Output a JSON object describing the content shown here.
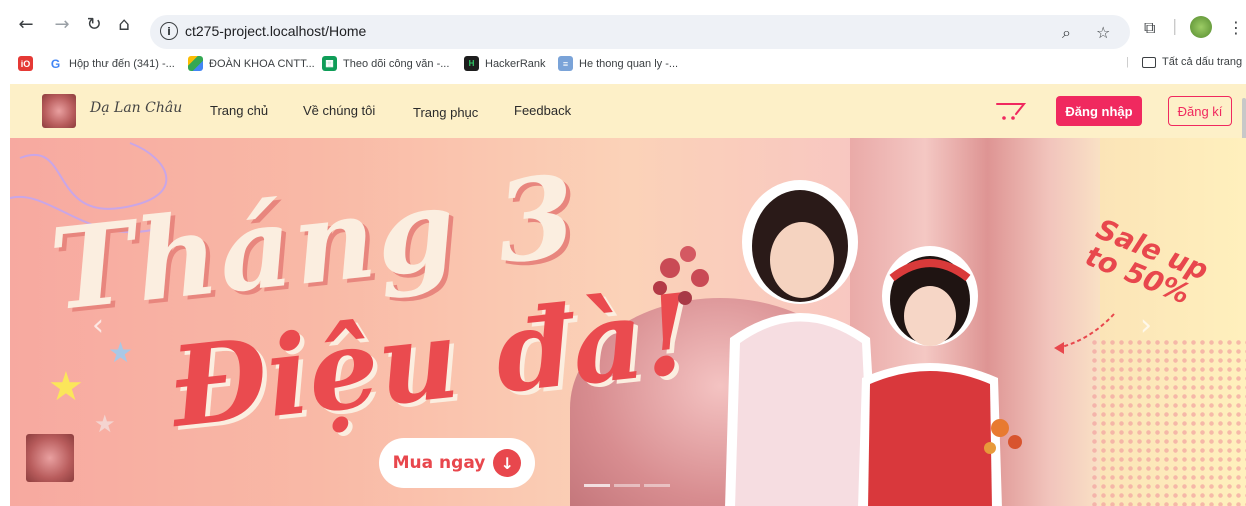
{
  "browser": {
    "url": "ct275-project.localhost/Home",
    "bookmarks": [
      {
        "label": "Hộp thư đến (341) -...",
        "icon": "gmail-icon"
      },
      {
        "label": "ĐOÀN KHOA CNTT...",
        "icon": "drive-icon"
      },
      {
        "label": "Theo dõi công văn -...",
        "icon": "sheets-icon"
      },
      {
        "label": "HackerRank",
        "icon": "hackerrank-icon"
      },
      {
        "label": "He thong quan ly -...",
        "icon": "table-icon"
      }
    ],
    "all_bookmarks_label": "Tất cả dấu trang"
  },
  "site": {
    "brand": "Dạ Lan Châu",
    "nav": [
      "Trang chủ",
      "Về chúng tôi",
      "Trang phục",
      "Feedback"
    ],
    "login_label": "Đăng nhập",
    "signup_label": "Đăng kí",
    "accent": "#f0295f"
  },
  "banner": {
    "headline_line1": "Tháng 3",
    "headline_line2": "Điệu đà!",
    "sale_line1": "Sale up",
    "sale_line2": "to 50%",
    "cta_label": "Mua ngay",
    "slides_count": 3,
    "active_slide": 1
  }
}
